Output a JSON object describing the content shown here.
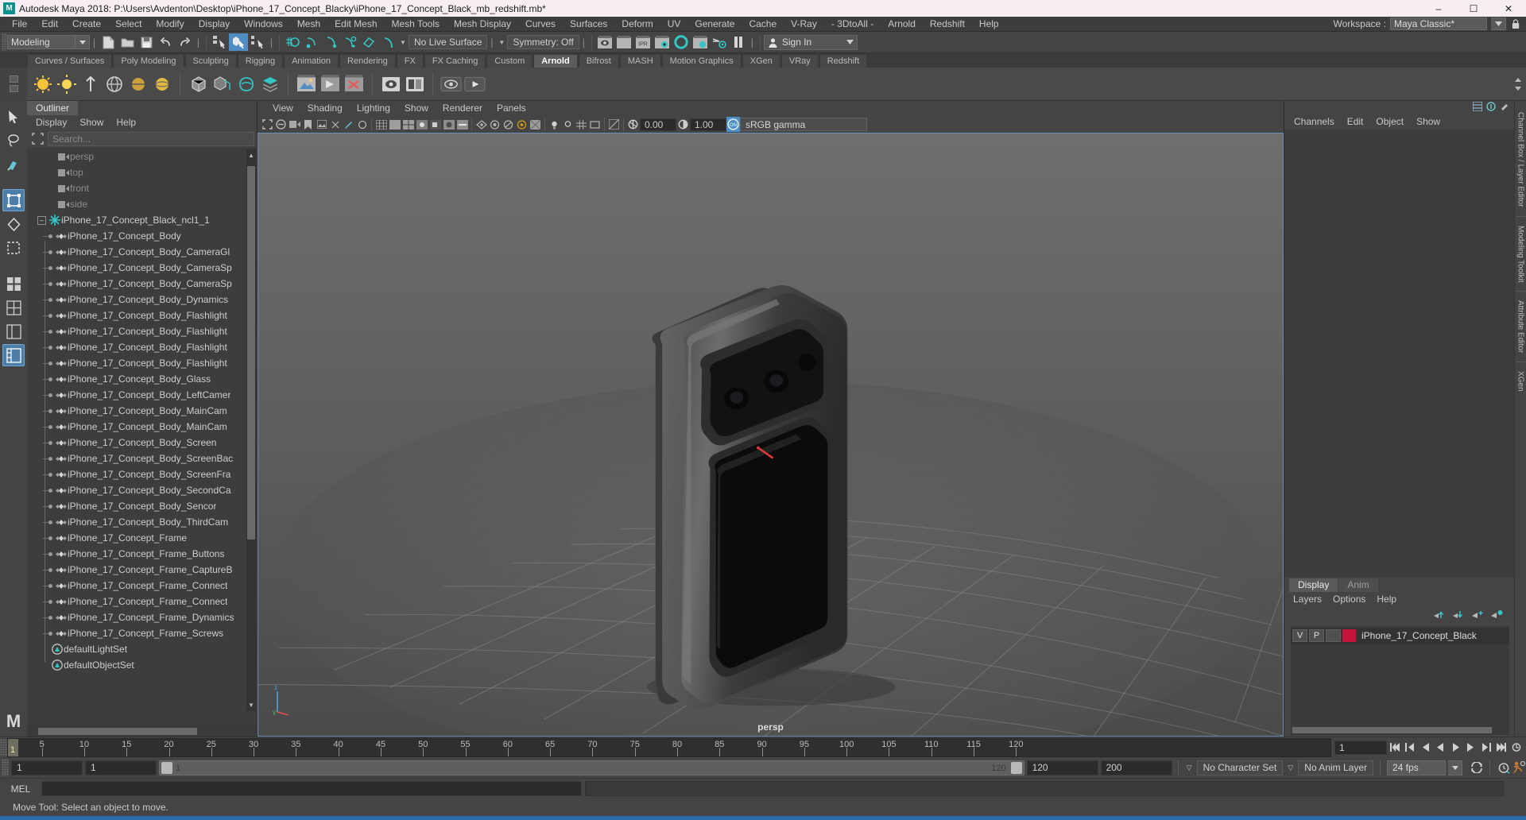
{
  "window": {
    "title": "Autodesk Maya 2018: P:\\Users\\Avdenton\\Desktop\\iPhone_17_Concept_Blacky\\iPhone_17_Concept_Black_mb_redshift.mb*",
    "logo_text": "M",
    "minimize": "–",
    "maximize": "☐",
    "close": "✕"
  },
  "menubar": {
    "items": [
      "File",
      "Edit",
      "Create",
      "Select",
      "Modify",
      "Display",
      "Windows",
      "Mesh",
      "Edit Mesh",
      "Mesh Tools",
      "Mesh Display",
      "Curves",
      "Surfaces",
      "Deform",
      "UV",
      "Generate",
      "Cache",
      "V-Ray",
      "- 3DtoAll -",
      "Arnold",
      "Redshift",
      "Help"
    ],
    "workspace_label": "Workspace :",
    "workspace_value": "Maya Classic*"
  },
  "statusline": {
    "mode": "Modeling",
    "live_surface": "No Live Surface",
    "symmetry": "Symmetry: Off",
    "signin": "Sign In"
  },
  "shelf": {
    "tabs": [
      "Curves / Surfaces",
      "Poly Modeling",
      "Sculpting",
      "Rigging",
      "Animation",
      "Rendering",
      "FX",
      "FX Caching",
      "Custom",
      "Arnold",
      "Bifrost",
      "MASH",
      "Motion Graphics",
      "XGen",
      "VRay",
      "Redshift"
    ],
    "active_tab": "Arnold"
  },
  "outliner": {
    "tab": "Outliner",
    "menu": [
      "Display",
      "Show",
      "Help"
    ],
    "search_placeholder": "Search...",
    "group_name": "iPhone_17_Concept_Black_ncl1_1",
    "cameras": [
      "persp",
      "top",
      "front",
      "side"
    ],
    "children": [
      "iPhone_17_Concept_Body",
      "iPhone_17_Concept_Body_CameraGl",
      "iPhone_17_Concept_Body_CameraSp",
      "iPhone_17_Concept_Body_CameraSp",
      "iPhone_17_Concept_Body_Dynamics",
      "iPhone_17_Concept_Body_Flashlight",
      "iPhone_17_Concept_Body_Flashlight",
      "iPhone_17_Concept_Body_Flashlight",
      "iPhone_17_Concept_Body_Flashlight",
      "iPhone_17_Concept_Body_Glass",
      "iPhone_17_Concept_Body_LeftCamer",
      "iPhone_17_Concept_Body_MainCam",
      "iPhone_17_Concept_Body_MainCam",
      "iPhone_17_Concept_Body_Screen",
      "iPhone_17_Concept_Body_ScreenBac",
      "iPhone_17_Concept_Body_ScreenFra",
      "iPhone_17_Concept_Body_SecondCa",
      "iPhone_17_Concept_Body_Sencor",
      "iPhone_17_Concept_Body_ThirdCam",
      "iPhone_17_Concept_Frame",
      "iPhone_17_Concept_Frame_Buttons",
      "iPhone_17_Concept_Frame_CaptureB",
      "iPhone_17_Concept_Frame_Connect",
      "iPhone_17_Concept_Frame_Connect",
      "iPhone_17_Concept_Frame_Dynamics",
      "iPhone_17_Concept_Frame_Screws"
    ],
    "sets": [
      "defaultLightSet",
      "defaultObjectSet"
    ]
  },
  "viewport": {
    "menu": [
      "View",
      "Shading",
      "Lighting",
      "Show",
      "Renderer",
      "Panels"
    ],
    "exposure": "0.00",
    "gamma": "1.00",
    "color_profile": "sRGB gamma",
    "camera_label": "persp"
  },
  "channelbox": {
    "menu": [
      "Channels",
      "Edit",
      "Object",
      "Show"
    ],
    "side_tabs": [
      "Channel Box / Layer Editor",
      "Modeling Toolkit",
      "Attribute Editor",
      "XGen"
    ]
  },
  "layer_editor": {
    "tabs": [
      "Display",
      "Anim"
    ],
    "active_tab": "Display",
    "menu": [
      "Layers",
      "Options",
      "Help"
    ],
    "layers": [
      {
        "visibility": "V",
        "playback": "P",
        "shading": "",
        "color": "#c4143c",
        "name": "iPhone_17_Concept_Black"
      }
    ]
  },
  "timeline": {
    "current_frame": "1",
    "ticks": [
      5,
      10,
      15,
      20,
      25,
      30,
      35,
      40,
      45,
      50,
      55,
      60,
      65,
      70,
      75,
      80,
      85,
      90,
      95,
      100,
      105,
      110,
      115,
      120
    ],
    "tick_start": 1,
    "tick_end": 124,
    "range_field": "1"
  },
  "rangeslider": {
    "start_field": "1",
    "range_start": "1",
    "slider_start_label": "1",
    "slider_end_label": "120",
    "range_end": "120",
    "end_field": "200",
    "character_set": "No Character Set",
    "anim_layer": "No Anim Layer",
    "fps": "24 fps"
  },
  "commandline": {
    "label": "MEL",
    "input_value": "",
    "result_value": ""
  },
  "helpline": {
    "text": "Move Tool: Select an object to move."
  },
  "colors": {
    "accent_blue": "#4f8ec4",
    "teal": "#34c6c6",
    "panel_bg": "#444444",
    "layer_red": "#c4143c"
  }
}
